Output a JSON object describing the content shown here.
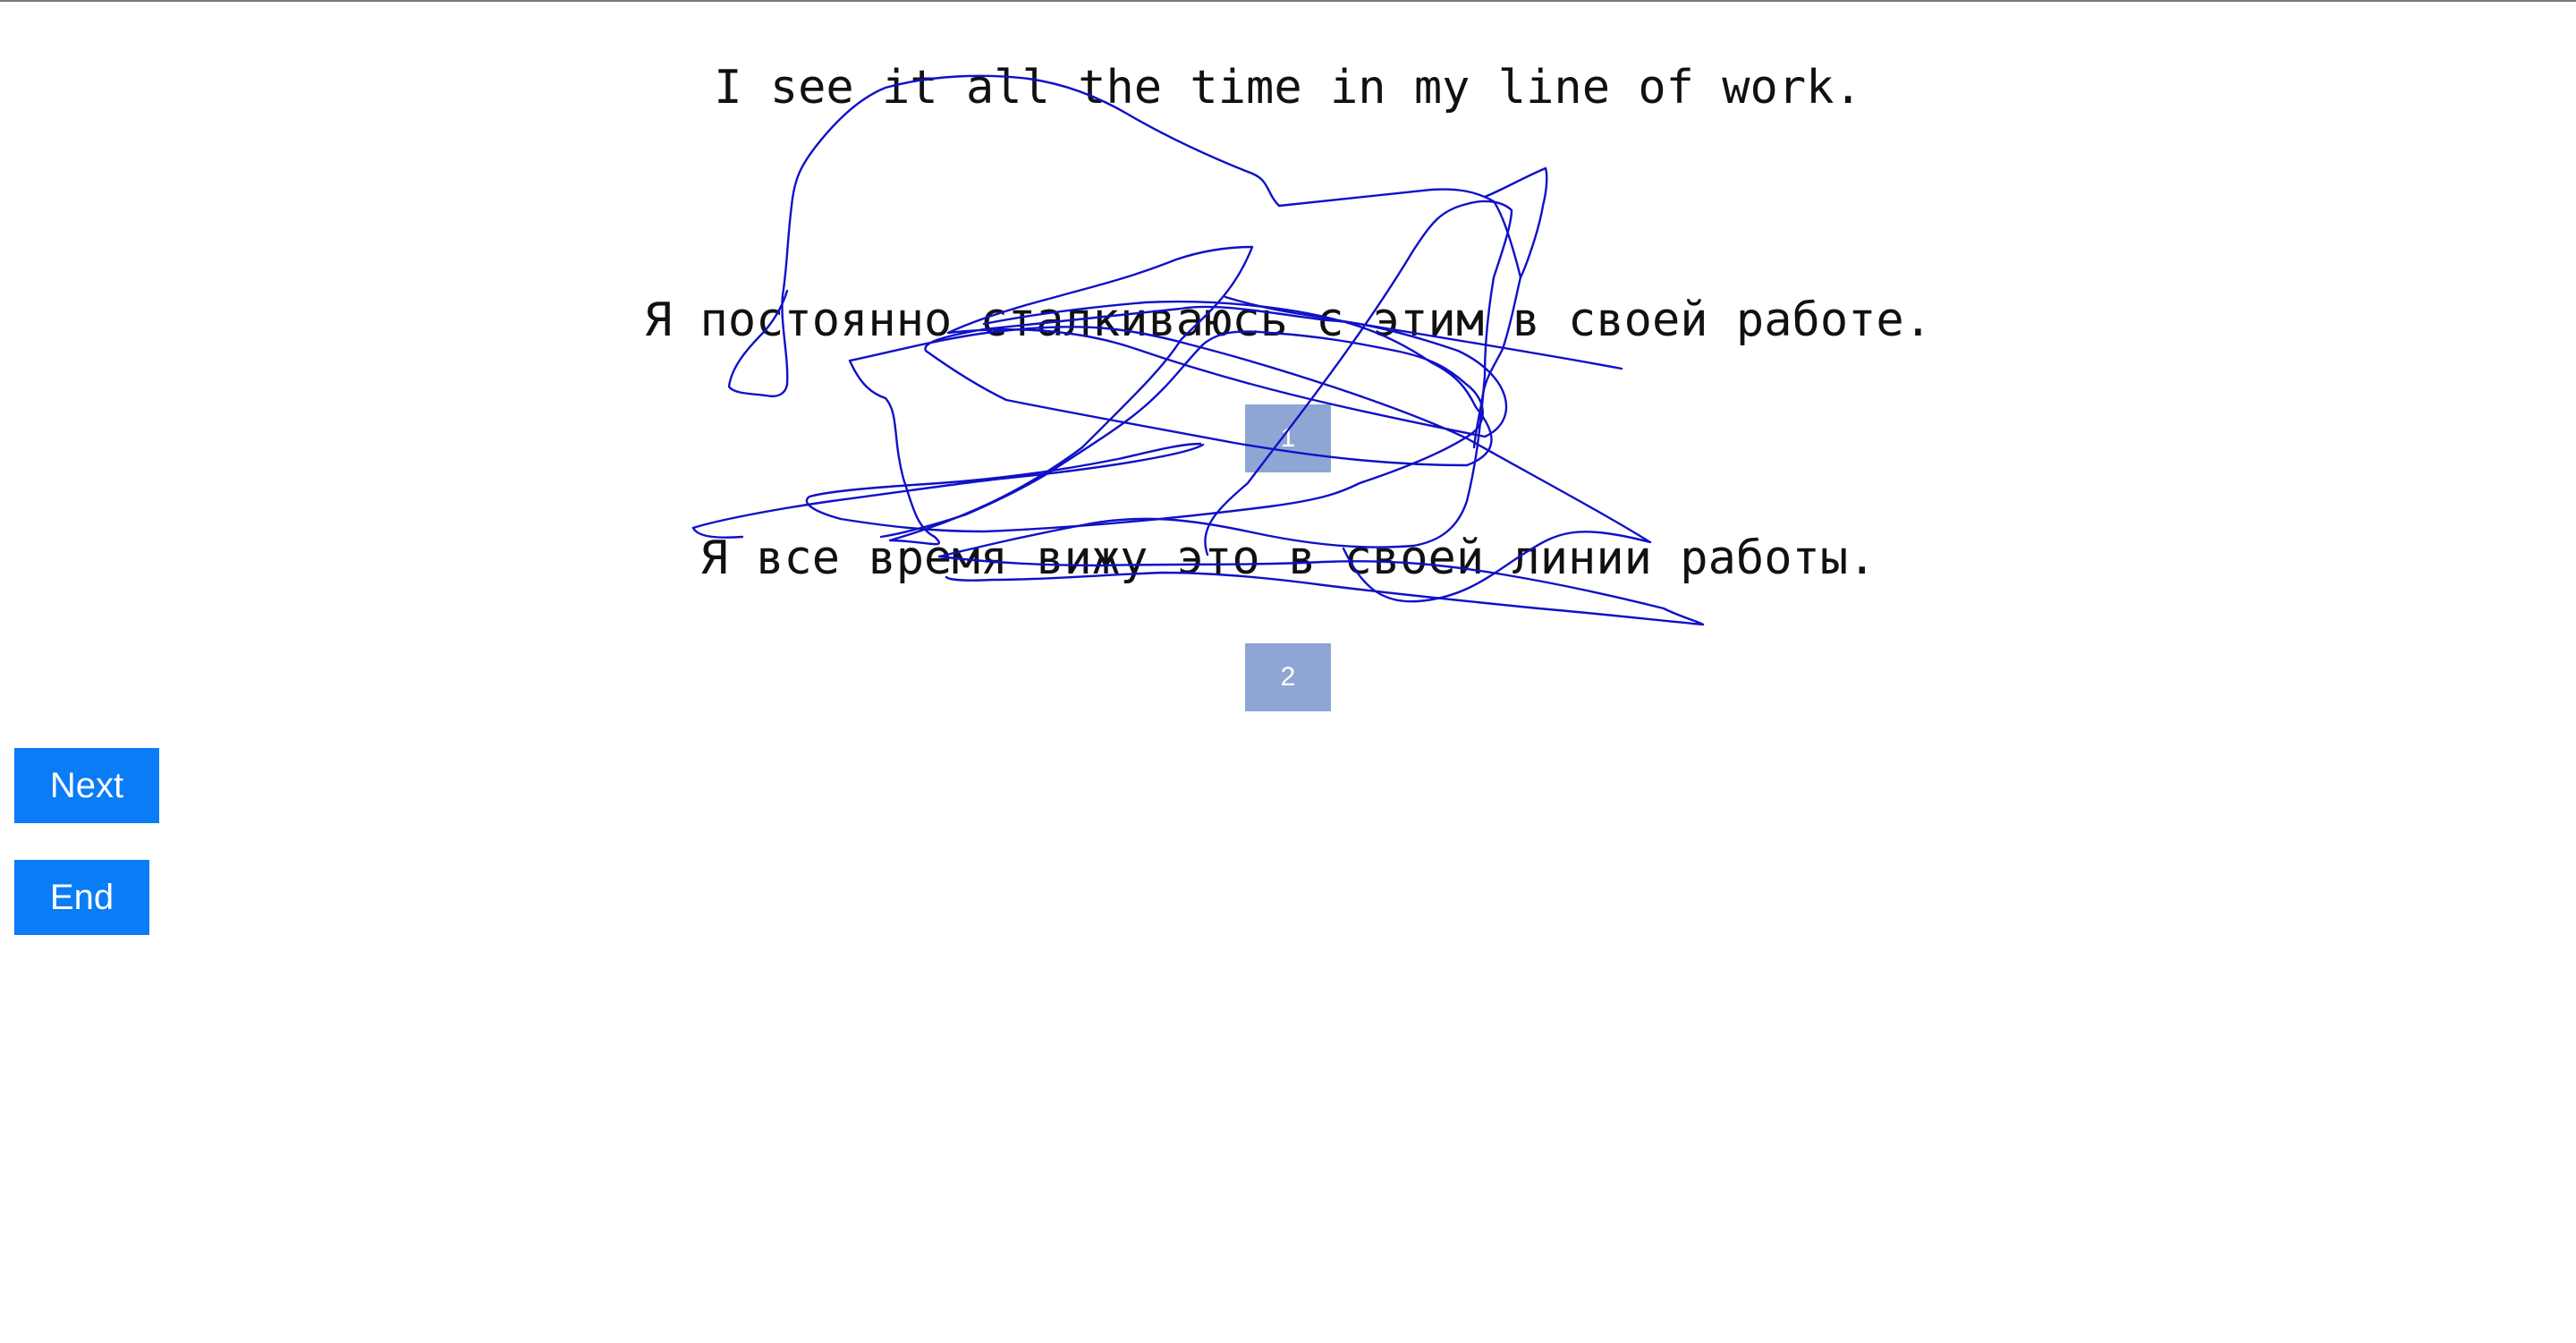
{
  "sentences": {
    "source": "I see it all the time in my line of work.",
    "translation_1": "Я постоянно сталкиваюсь с этим в своей работе.",
    "translation_2": "Я все время вижу это в своей линии работы."
  },
  "choices": {
    "one": "1",
    "two": "2"
  },
  "buttons": {
    "next": "Next",
    "end": "End"
  },
  "colors": {
    "choice_box": "#8fa6d4",
    "button": "#0a7cf6",
    "scribble": "#1010c8"
  }
}
